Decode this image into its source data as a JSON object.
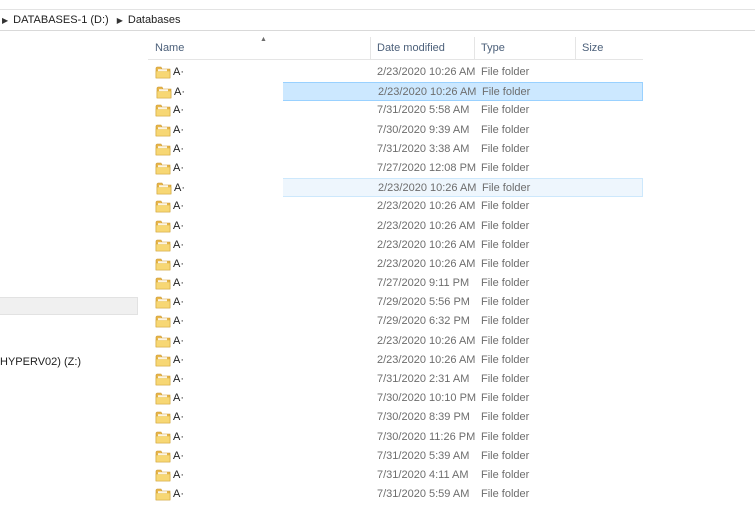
{
  "address_bar": {
    "crumbs": [
      "DATABASES-1 (D:)",
      "Databases"
    ]
  },
  "nav_pane": {
    "drive_label": "HYPERV02) (Z:)"
  },
  "columns": {
    "name": "Name",
    "date_modified": "Date modified",
    "type": "Type",
    "size": "Size"
  },
  "files": [
    {
      "name": "A·",
      "date": "2/23/2020 10:26 AM",
      "type": "File folder",
      "state": "normal"
    },
    {
      "name": "A·",
      "date": "2/23/2020 10:26 AM",
      "type": "File folder",
      "state": "selected"
    },
    {
      "name": "A·",
      "date": "7/31/2020 5:58 AM",
      "type": "File folder",
      "state": "normal"
    },
    {
      "name": "A·",
      "date": "7/30/2020 9:39 AM",
      "type": "File folder",
      "state": "normal"
    },
    {
      "name": "A·",
      "date": "7/31/2020 3:38 AM",
      "type": "File folder",
      "state": "normal"
    },
    {
      "name": "A·",
      "date": "7/27/2020 12:08 PM",
      "type": "File folder",
      "state": "normal"
    },
    {
      "name": "A·",
      "date": "2/23/2020 10:26 AM",
      "type": "File folder",
      "state": "hover"
    },
    {
      "name": "A·",
      "date": "2/23/2020 10:26 AM",
      "type": "File folder",
      "state": "normal"
    },
    {
      "name": "A·",
      "date": "2/23/2020 10:26 AM",
      "type": "File folder",
      "state": "normal"
    },
    {
      "name": "A·",
      "date": "2/23/2020 10:26 AM",
      "type": "File folder",
      "state": "normal"
    },
    {
      "name": "A·",
      "date": "2/23/2020 10:26 AM",
      "type": "File folder",
      "state": "normal"
    },
    {
      "name": "A·",
      "date": "7/27/2020 9:11 PM",
      "type": "File folder",
      "state": "normal"
    },
    {
      "name": "A·",
      "date": "7/29/2020 5:56 PM",
      "type": "File folder",
      "state": "normal"
    },
    {
      "name": "A·",
      "date": "7/29/2020 6:32 PM",
      "type": "File folder",
      "state": "normal"
    },
    {
      "name": "A·",
      "date": "2/23/2020 10:26 AM",
      "type": "File folder",
      "state": "normal"
    },
    {
      "name": "A·",
      "date": "2/23/2020 10:26 AM",
      "type": "File folder",
      "state": "normal"
    },
    {
      "name": "A·",
      "date": "7/31/2020 2:31 AM",
      "type": "File folder",
      "state": "normal"
    },
    {
      "name": "A·",
      "date": "7/30/2020 10:10 PM",
      "type": "File folder",
      "state": "normal"
    },
    {
      "name": "A·",
      "date": "7/30/2020 8:39 PM",
      "type": "File folder",
      "state": "normal"
    },
    {
      "name": "A·",
      "date": "7/30/2020 11:26 PM",
      "type": "File folder",
      "state": "normal"
    },
    {
      "name": "A·",
      "date": "7/31/2020 5:39 AM",
      "type": "File folder",
      "state": "normal"
    },
    {
      "name": "A·",
      "date": "7/31/2020 4:11 AM",
      "type": "File folder",
      "state": "normal"
    },
    {
      "name": "A·",
      "date": "7/31/2020 5:59 AM",
      "type": "File folder",
      "state": "normal"
    }
  ],
  "icons": {
    "folder": "folder-icon",
    "breadcrumb_separator": "chevron-right-icon",
    "sort_indicator": "sort-ascending-icon"
  },
  "colors": {
    "selected_bg": "#cce8ff",
    "selected_border": "#99d1ff",
    "hover_bg": "#eef6fd",
    "header_text": "#4c607a",
    "secondary_text": "#6d6d6d"
  }
}
